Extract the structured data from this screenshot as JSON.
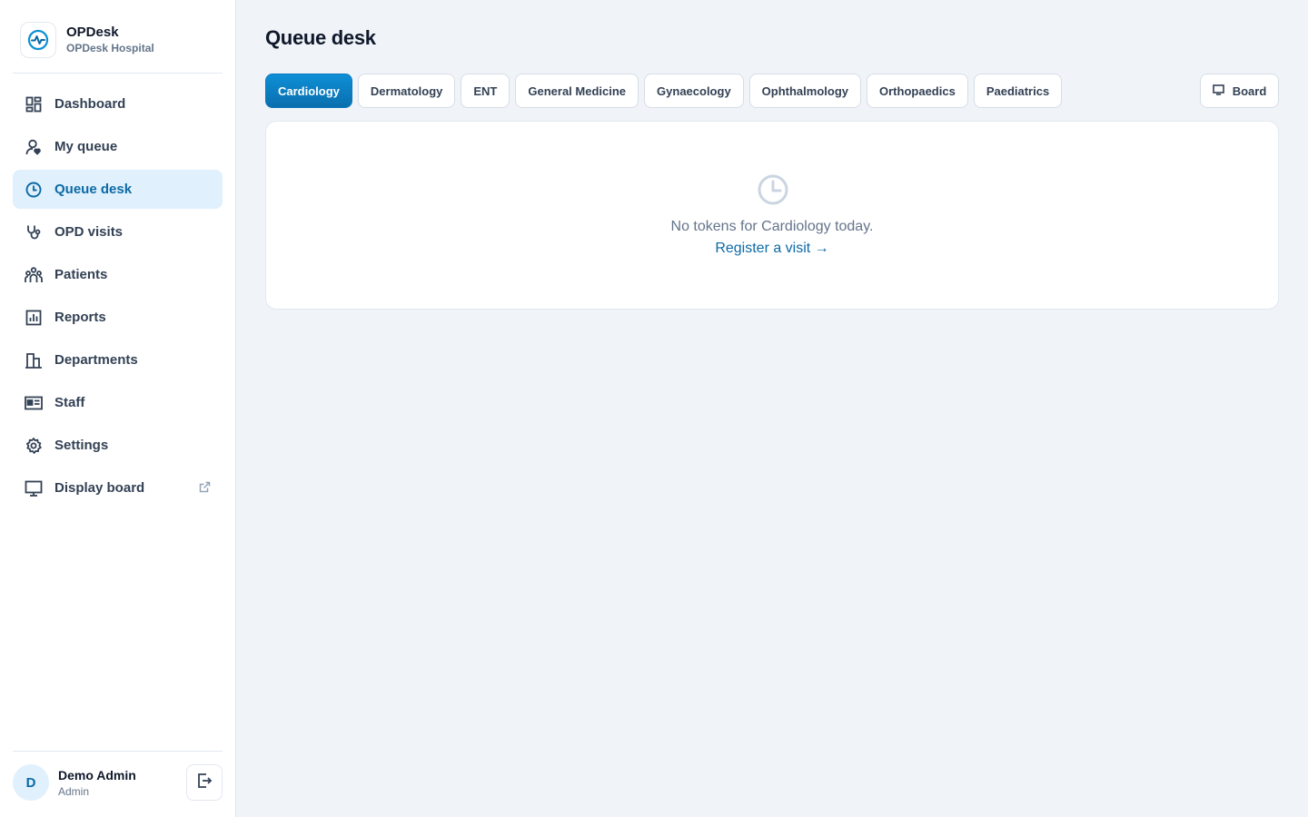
{
  "brand": {
    "name": "OPDesk",
    "hospital": "OPDesk Hospital",
    "logo_icon": "pulse-icon",
    "accent": "#0b6aa6"
  },
  "sidebar": {
    "items": [
      {
        "label": "Dashboard",
        "icon": "dashboard-icon"
      },
      {
        "label": "My queue",
        "icon": "user-heart-icon"
      },
      {
        "label": "Queue desk",
        "icon": "clock-icon",
        "active": true
      },
      {
        "label": "OPD visits",
        "icon": "stethoscope-icon"
      },
      {
        "label": "Patients",
        "icon": "people-icon"
      },
      {
        "label": "Reports",
        "icon": "bar-chart-icon"
      },
      {
        "label": "Departments",
        "icon": "building-icon"
      },
      {
        "label": "Staff",
        "icon": "id-card-icon"
      },
      {
        "label": "Settings",
        "icon": "gear-icon"
      },
      {
        "label": "Display board",
        "icon": "monitor-icon",
        "external_icon": "external-link-icon"
      }
    ]
  },
  "user": {
    "initial": "D",
    "name": "Demo Admin",
    "role": "Admin",
    "logout_icon": "logout-icon"
  },
  "main": {
    "title": "Queue desk",
    "tabs": [
      {
        "label": "Cardiology",
        "active": true
      },
      {
        "label": "Dermatology"
      },
      {
        "label": "ENT"
      },
      {
        "label": "General Medicine"
      },
      {
        "label": "Gynaecology"
      },
      {
        "label": "Ophthalmology"
      },
      {
        "label": "Orthopaedics"
      },
      {
        "label": "Paediatrics"
      }
    ],
    "board_button": {
      "label": "Board",
      "icon": "monitor-icon"
    },
    "empty_state": {
      "icon": "clock-icon",
      "message": "No tokens for Cardiology today.",
      "link": "Register a visit →"
    }
  }
}
